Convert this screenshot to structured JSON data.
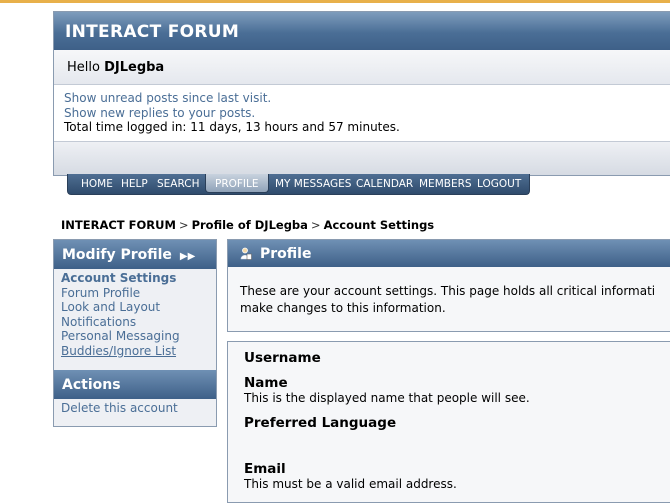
{
  "header": {
    "title": "INTERACT FORUM",
    "hello_prefix": "Hello",
    "username": "DJLegba",
    "links": [
      "Show unread posts since last visit.",
      "Show new replies to your posts."
    ],
    "time_logged": "Total time logged in: 11 days, 13 hours and 57 minutes."
  },
  "menu": [
    "HOME",
    "HELP",
    "SEARCH",
    "PROFILE",
    "MY MESSAGES",
    "CALENDAR",
    "MEMBERS",
    "LOGOUT"
  ],
  "menu_active": "PROFILE",
  "breadcrumb": [
    "INTERACT FORUM",
    "Profile of DJLegba",
    "Account Settings"
  ],
  "breadcrumb_sep": ">",
  "sidebar": {
    "modify_title": "Modify Profile",
    "modify_items": [
      "Account Settings",
      "Forum Profile",
      "Look and Layout",
      "Notifications",
      "Personal Messaging",
      "Buddies/Ignore List"
    ],
    "actions_title": "Actions",
    "actions_items": [
      "Delete this account"
    ]
  },
  "profile": {
    "title": "Profile",
    "desc_line1": "These are your account settings. This page holds all critical informati",
    "desc_line2": "make changes to this information."
  },
  "fields": [
    {
      "label": "Username",
      "desc": ""
    },
    {
      "label": "Name",
      "desc": "This is the displayed name that people will see."
    },
    {
      "label": "Preferred Language",
      "desc": ""
    },
    {
      "label": "Email",
      "desc": "This must be a valid email address."
    }
  ],
  "colors": {
    "accent": "#4a6e96",
    "header_dark": "#3e6088",
    "link": "#4a6e96"
  }
}
